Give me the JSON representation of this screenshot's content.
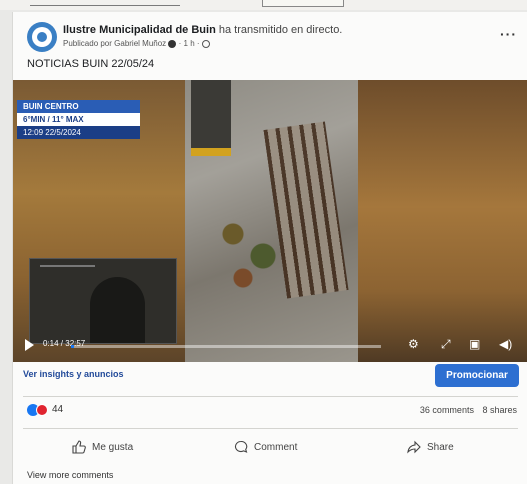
{
  "post": {
    "page_name": "Ilustre Municipalidad de Buin",
    "action": "ha transmitido en directo.",
    "published_by": "Publicado por Gabriel Muñoz",
    "time_ago": "1 h",
    "more_icon": "more-dots-icon",
    "text": "NOTICIAS BUIN 22/05/24"
  },
  "video": {
    "overlay": {
      "location": "BUIN CENTRO",
      "temps": "6°MIN / 11° MAX",
      "datetime": "12:09  22/5/2024"
    },
    "time": "0:14 / 32:57",
    "progress": 0.01,
    "accent_color": "#1877f2"
  },
  "actions": {
    "insights": "Ver insights y anuncios",
    "promote": "Promocionar"
  },
  "reactions": {
    "count": "44",
    "comments": "36 comments",
    "shares": "8 shares"
  },
  "buttons": {
    "like": "Me gusta",
    "comment": "Comment",
    "share": "Share"
  },
  "view_more": "View more comments"
}
